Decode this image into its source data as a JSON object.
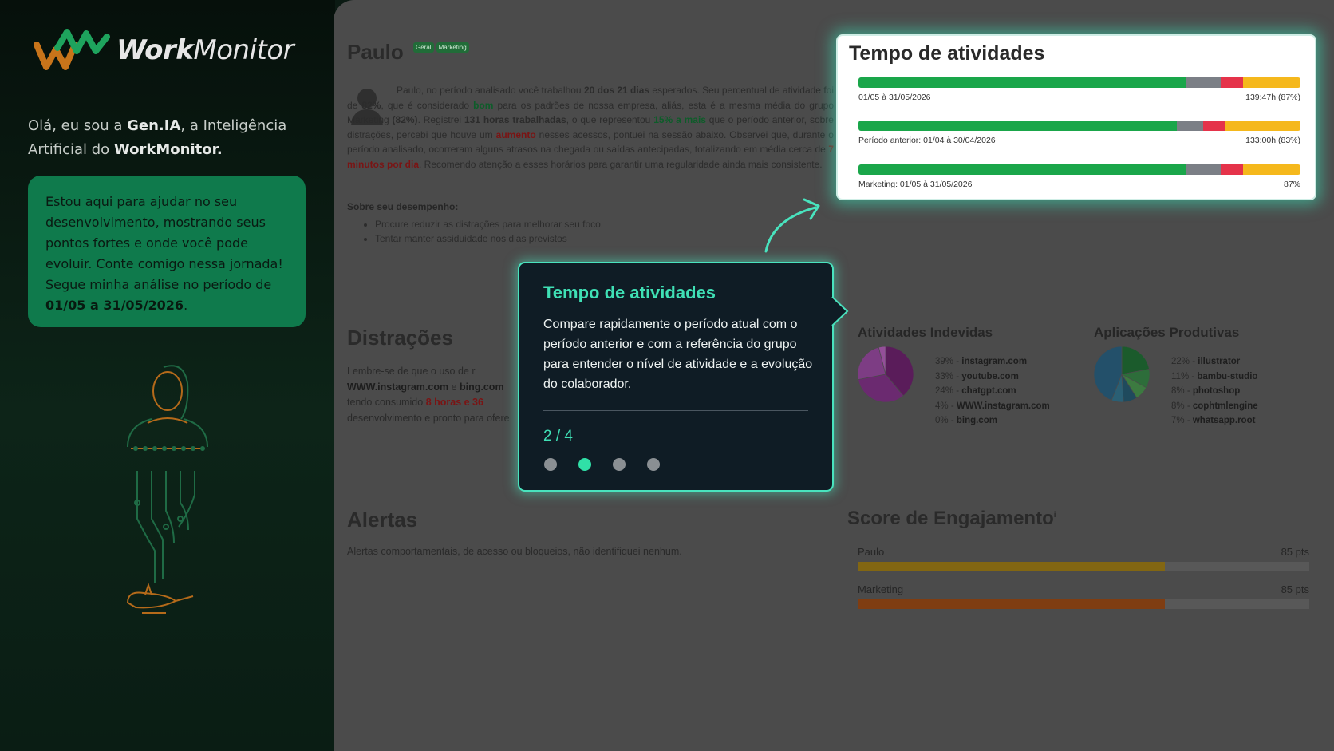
{
  "brand": {
    "logo_part1": "Work",
    "logo_part2": "Monitor"
  },
  "assistant": {
    "intro_prefix": "Olá, eu sou a ",
    "ai_name": "Gen.IA",
    "intro_middle": ", a Inteligência Artificial do ",
    "app_name": "WorkMonitor.",
    "card_text": "Estou aqui para ajudar no seu desenvolvimento, mostrando seus pontos fortes e onde você pode evoluir. Conte comigo nessa jornada! Segue minha análise no período de ",
    "card_period": "01/05 a 31/05/2026",
    "card_end": "."
  },
  "profile": {
    "name": "Paulo",
    "badges": [
      "Geral",
      "Marketing"
    ],
    "summary": {
      "p1": "Paulo, no período analisado você trabalhou ",
      "days": "20 dos 21 dias",
      "p2": " esperados. Seu percentual de atividade foi de ",
      "pct": "82%",
      "p3": ", que é considerado ",
      "quality": "bom",
      "p4": " para os padrões de nossa empresa, aliás, esta é a mesma média do grupo Marketing ",
      "group_pct": "(82%)",
      "p5": ". Registrei ",
      "hours": "131 horas trabalhadas",
      "p6": ", o que representou ",
      "diff": "15% a mais",
      "p7": " que o período anterior, sobre distrações, percebi que houve um ",
      "increase": "aumento",
      "p8": " nesses acessos, pontuei na sessão abaixo. Observei que, durante o período analisado, ocorreram alguns atrasos na chegada ou saídas antecipadas, totalizando em média cerca de ",
      "late": "7 minutos por dia",
      "p9": ". Recomendo atenção a esses horários para garantir uma regularidade ainda mais consistente."
    },
    "performance_title": "Sobre seu desempenho:",
    "performance_items": [
      "Procure reduzir as distrações para melhorar seu foco.",
      "Tentar manter assiduidade nos dias previstos"
    ]
  },
  "distractions": {
    "title": "Distrações",
    "t1": "Lembre-se de que o uso de r",
    "site1": "WWW.instagram.com",
    "t2": " e ",
    "site2": "bing.com",
    "t3": "tendo consumido ",
    "hours": "8 horas e 36",
    "t4": "desenvolvimento e pronto para ofere"
  },
  "alerts": {
    "title": "Alertas",
    "text": "Alertas comportamentais, de acesso ou bloqueios, não identifiquei nenhum."
  },
  "activity_card": {
    "title": "Tempo de atividades",
    "rows": [
      {
        "label": "01/05 à 31/05/2026",
        "value": "139:47h (87%)",
        "segments": [
          74,
          8,
          5,
          13
        ]
      },
      {
        "label": "Período anterior: 01/04 à 30/04/2026",
        "value": "133:00h (83%)",
        "segments": [
          72,
          6,
          5,
          17
        ]
      },
      {
        "label": "Marketing: 01/05 à 31/05/2026",
        "value": "87%",
        "segments": [
          74,
          8,
          5,
          13
        ]
      }
    ],
    "segment_colors": [
      "#1aa64a",
      "#7b7f86",
      "#e5334a",
      "#f5b81c"
    ]
  },
  "improper": {
    "title": "Atividades Indevidas",
    "items": [
      {
        "pct": "39% - ",
        "name": "instagram.com",
        "value": 39,
        "color": "#5a1c5a"
      },
      {
        "pct": "33% - ",
        "name": "youtube.com",
        "value": 33,
        "color": "#6b2a70"
      },
      {
        "pct": "24% - ",
        "name": "chatgpt.com",
        "value": 24,
        "color": "#7d3d84"
      },
      {
        "pct": "4% - ",
        "name": "WWW.instagram.com",
        "value": 4,
        "color": "#944f99"
      },
      {
        "pct": "0% - ",
        "name": "bing.com",
        "value": 0,
        "color": "#a866ad"
      }
    ]
  },
  "productive": {
    "title": "Aplicações Produtivas",
    "items": [
      {
        "pct": "22% - ",
        "name": "illustrator",
        "value": 22,
        "color": "#1b5b2c"
      },
      {
        "pct": "11% - ",
        "name": "bambu-studio",
        "value": 11,
        "color": "#2d6d3a"
      },
      {
        "pct": "8% - ",
        "name": "photoshop",
        "value": 8,
        "color": "#3c7a40"
      },
      {
        "pct": "8% - ",
        "name": "cophtmlengine",
        "value": 8,
        "color": "#1f4a5d"
      },
      {
        "pct": "7% - ",
        "name": "whatsapp.root",
        "value": 7,
        "color": "#2a5f74"
      }
    ]
  },
  "score": {
    "title": "Score de Engajamento",
    "info_mark": "i",
    "rows": [
      {
        "label": "Paulo",
        "pts": "85 pts",
        "value": 68,
        "color": "#826612"
      },
      {
        "label": "Marketing",
        "pts": "85 pts",
        "value": 68,
        "color": "#7f3d12"
      }
    ]
  },
  "tooltip": {
    "title": "Tempo de atividades",
    "body": "Compare rapidamente o período atual com o período anterior e com a referência do grupo para entender o nível de atividade e a evolução do colaborador.",
    "step": "2 / 4",
    "total_steps": 4,
    "current_step": 2
  }
}
